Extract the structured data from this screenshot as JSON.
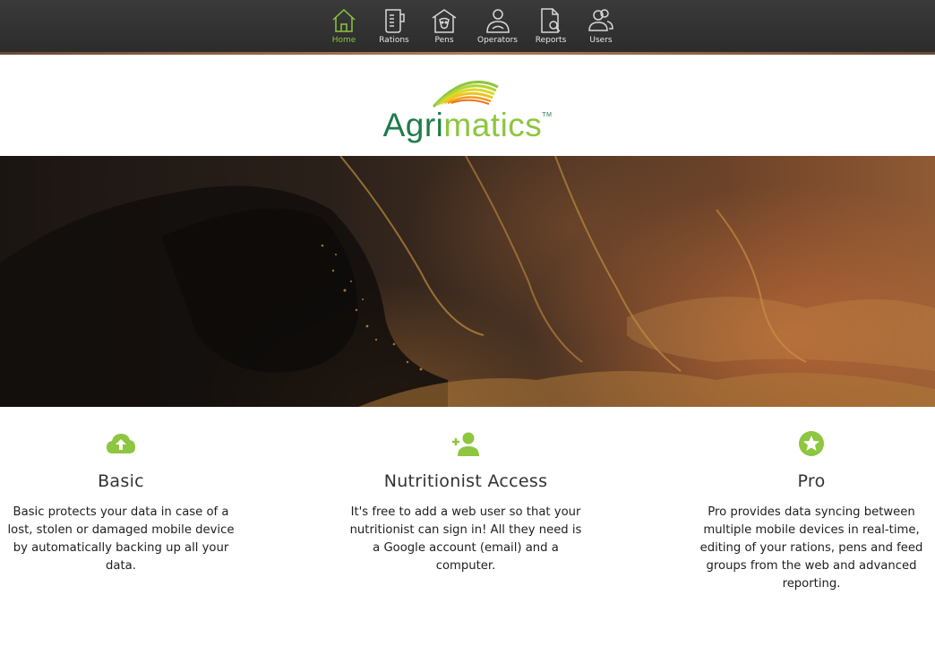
{
  "nav": {
    "items": [
      {
        "label": "Home",
        "icon": "home-icon",
        "active": true
      },
      {
        "label": "Rations",
        "icon": "rations-icon",
        "active": false
      },
      {
        "label": "Pens",
        "icon": "pens-icon",
        "active": false
      },
      {
        "label": "Operators",
        "icon": "operators-icon",
        "active": false
      },
      {
        "label": "Reports",
        "icon": "reports-icon",
        "active": false
      },
      {
        "label": "Users",
        "icon": "users-icon",
        "active": false
      }
    ]
  },
  "logo": {
    "part1": "Agri",
    "part2": "matics",
    "tm": "TM"
  },
  "features": [
    {
      "icon": "cloud-upload-icon",
      "title": "Basic",
      "text": "Basic protects your data in case of a lost, stolen or damaged mobile device by automatically backing up all your data."
    },
    {
      "icon": "add-user-icon",
      "title": "Nutritionist Access",
      "text": "It's free to add a web user so that your nutritionist can sign in! All they need is a Google account (email) and a computer."
    },
    {
      "icon": "star-circle-icon",
      "title": "Pro",
      "text": "Pro provides data syncing between multiple mobile devices in real-time, editing of your rations, pens and feed groups from the web and advanced reporting."
    }
  ],
  "colors": {
    "accent": "#8dc63f",
    "brand_dark": "#1f7b4a",
    "topbar": "#333333"
  }
}
